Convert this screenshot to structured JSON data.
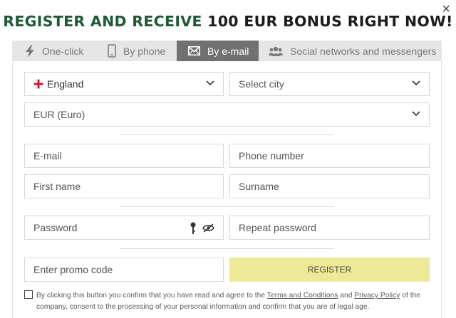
{
  "close_label": "×",
  "headline": {
    "part1": "REGISTER AND RECEIVE ",
    "part2": "100 EUR BONUS RIGHT NOW!"
  },
  "tabs": [
    {
      "label": "One-click",
      "icon": "lightning-icon",
      "active": false
    },
    {
      "label": "By phone",
      "icon": "phone-icon",
      "active": false
    },
    {
      "label": "By e-mail",
      "icon": "envelope-icon",
      "active": true
    },
    {
      "label": "Social networks and messengers",
      "icon": "users-icon",
      "active": false
    }
  ],
  "form": {
    "country": "England",
    "city_placeholder": "Select city",
    "currency": "EUR (Euro)",
    "email_placeholder": "E-mail",
    "phone_placeholder": "Phone number",
    "first_name_placeholder": "First name",
    "surname_placeholder": "Surname",
    "password_placeholder": "Password",
    "repeat_password_placeholder": "Repeat password",
    "promo_placeholder": "Enter promo code",
    "register_label": "REGISTER"
  },
  "consent": {
    "text_before": "By clicking this button you confirm that you have read and agree to the ",
    "terms_link": "Terms and Conditions",
    "text_and": " and ",
    "privacy_link": "Privacy Policy",
    "text_after": " of the company, consent to the processing of your personal information and confirm that you are of legal age."
  },
  "colors": {
    "headline_green": "#1e5a35",
    "active_tab": "#717171",
    "register_button": "#ecea98"
  }
}
